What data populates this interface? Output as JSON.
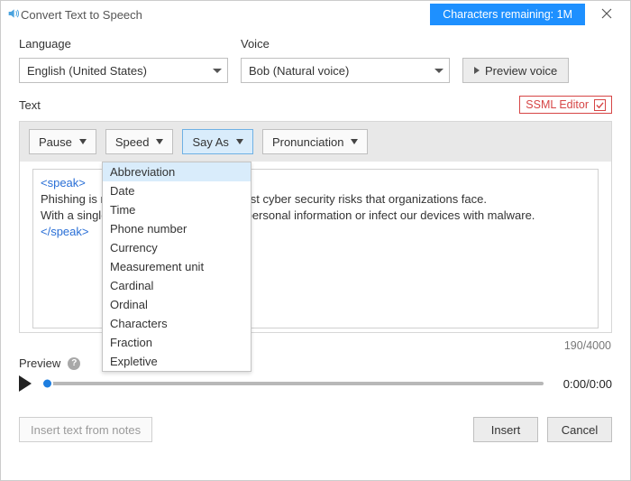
{
  "titlebar": {
    "title": "Convert Text to Speech",
    "char_remaining": "Characters remaining: 1M"
  },
  "fields": {
    "language_label": "Language",
    "language_value": "English (United States)",
    "voice_label": "Voice",
    "voice_value": "Bob (Natural voice)",
    "preview_voice": "Preview voice"
  },
  "text_section": {
    "label": "Text",
    "ssml_label": "SSML Editor"
  },
  "toolbar": {
    "pause": "Pause",
    "speed": "Speed",
    "say_as": "Say As",
    "pronunciation": "Pronunciation"
  },
  "say_as_menu": [
    "Abbreviation",
    "Date",
    "Time",
    "Phone number",
    "Currency",
    "Measurement unit",
    "Cardinal",
    "Ordinal",
    "Characters",
    "Fraction",
    "Expletive"
  ],
  "editor": {
    "open_tag": "<speak>",
    "line1": "Phishing is regarded as one of the biggest cyber security risks that organizations face.",
    "line2": "With a single touch, criminals can steal personal information or infect our devices with malware.",
    "close_tag": "</speak>",
    "counter": "190/4000"
  },
  "preview": {
    "label": "Preview",
    "time": "0:00/0:00"
  },
  "bottom": {
    "insert_notes": "Insert text from notes",
    "insert": "Insert",
    "cancel": "Cancel"
  }
}
